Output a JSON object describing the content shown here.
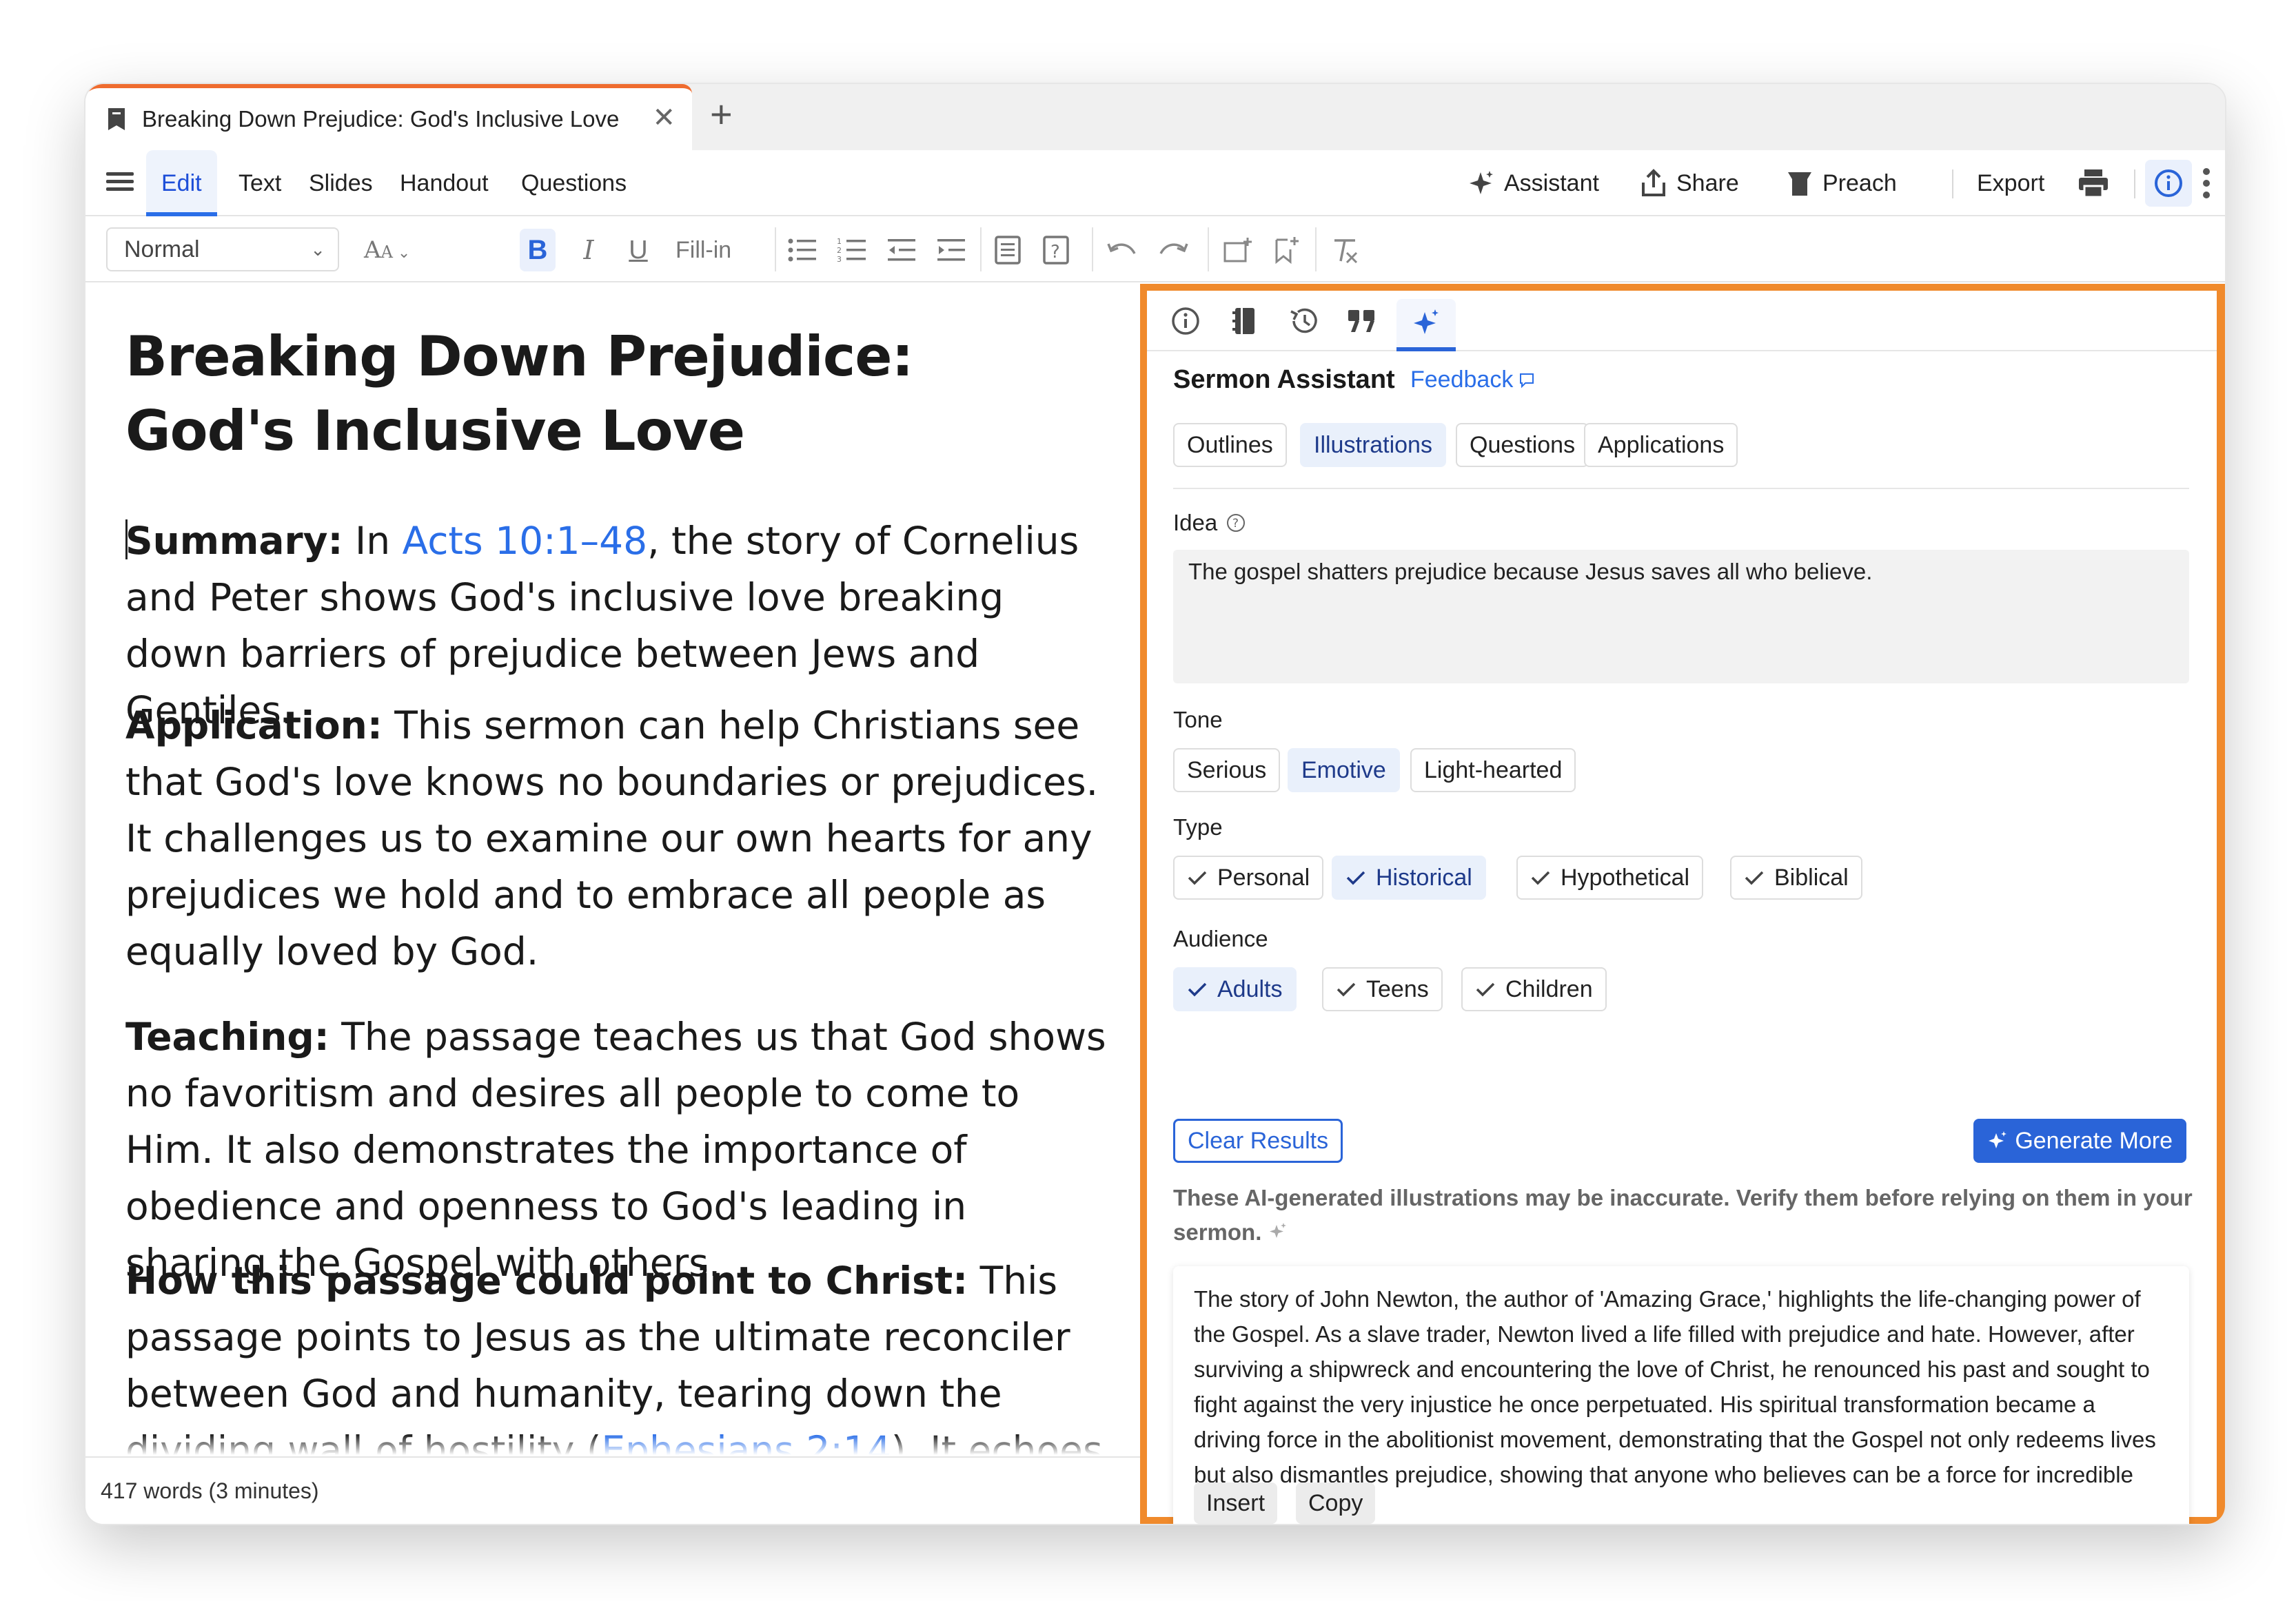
{
  "tab": {
    "title": "Breaking Down Prejudice: God's Inclusive Love",
    "close": "✕",
    "new": "+"
  },
  "menu": {
    "items": [
      "Edit",
      "Text",
      "Slides",
      "Handout",
      "Questions"
    ],
    "assistant": "Assistant",
    "share": "Share",
    "preach": "Preach",
    "export": "Export"
  },
  "format": {
    "style": "Normal",
    "fill_in": "Fill-in"
  },
  "document": {
    "title": "Breaking Down Prejudice: God's Inclusive Love",
    "summary_label": "Summary:",
    "summary_pre": " In ",
    "summary_link": "Acts 10:1–48",
    "summary_post": ", the story of Cornelius and Peter shows God's inclusive love breaking down barriers of prejudice between Jews and Gentiles.",
    "application_label": "Application:",
    "application_text": " This sermon can help Christians see that God's love knows no boundaries or prejudices. It challenges us to examine our own hearts for any prejudices we hold and to embrace all people as equally loved by God.",
    "teaching_label": "Teaching:",
    "teaching_text": " The passage teaches us that God shows no favoritism and desires all people to come to Him. It also demonstrates the importance of obedience and openness to God's leading in sharing the Gospel with others.",
    "christ_label": "How this passage could point to Christ:",
    "christ_text": " This passage points to Jesus as the ultimate reconciler between God and humanity, tearing down the dividing wall of hostility (",
    "christ_link": "Ephesians 2:14",
    "christ_text2": "). It echoes the message of God's promise"
  },
  "status": {
    "word_count": "417 words (3 minutes)"
  },
  "assistant": {
    "title": "Sermon Assistant",
    "feedback": "Feedback",
    "modes": [
      "Outlines",
      "Illustrations",
      "Questions",
      "Applications"
    ],
    "selected_mode": "Illustrations",
    "idea_label": "Idea",
    "idea_value": "The gospel shatters prejudice because Jesus saves all who believe.",
    "tone_label": "Tone",
    "tones": [
      "Serious",
      "Emotive",
      "Light-hearted"
    ],
    "type_label": "Type",
    "types": [
      "Personal",
      "Historical",
      "Hypothetical",
      "Biblical"
    ],
    "audience_label": "Audience",
    "audiences": [
      "Adults",
      "Teens",
      "Children"
    ],
    "clear_label": "Clear Results",
    "generate_label": "Generate More",
    "disclaimer": "These AI-generated illustrations may be inaccurate. Verify them before relying on them in your sermon.",
    "result_text": "The story of John Newton, the author of 'Amazing Grace,' highlights the life-changing power of the Gospel. As a slave trader, Newton lived a life filled with prejudice and hate. However, after surviving a shipwreck and encountering the love of Christ, he renounced his past and sought to fight against the very injustice he once perpetuated. His spiritual transformation became a driving force in the abolitionist movement, demonstrating that the Gospel not only redeems lives but also dismantles prejudice, showing that anyone who believes can be a force for incredible change.",
    "insert_label": "Insert",
    "copy_label": "Copy"
  },
  "colors": {
    "accent": "#2a64d8",
    "panel_border": "#f08a2c",
    "tab_accent": "#ef6c2f",
    "link": "#2a6ee8"
  },
  "icons": [
    "document-icon",
    "hamburger-icon",
    "sparkle-icon",
    "share-icon",
    "preach-icon",
    "print-icon",
    "info-icon",
    "more-icon",
    "history-icon",
    "quote-icon",
    "library-icon",
    "help-icon",
    "feedback-icon",
    "check-icon"
  ]
}
